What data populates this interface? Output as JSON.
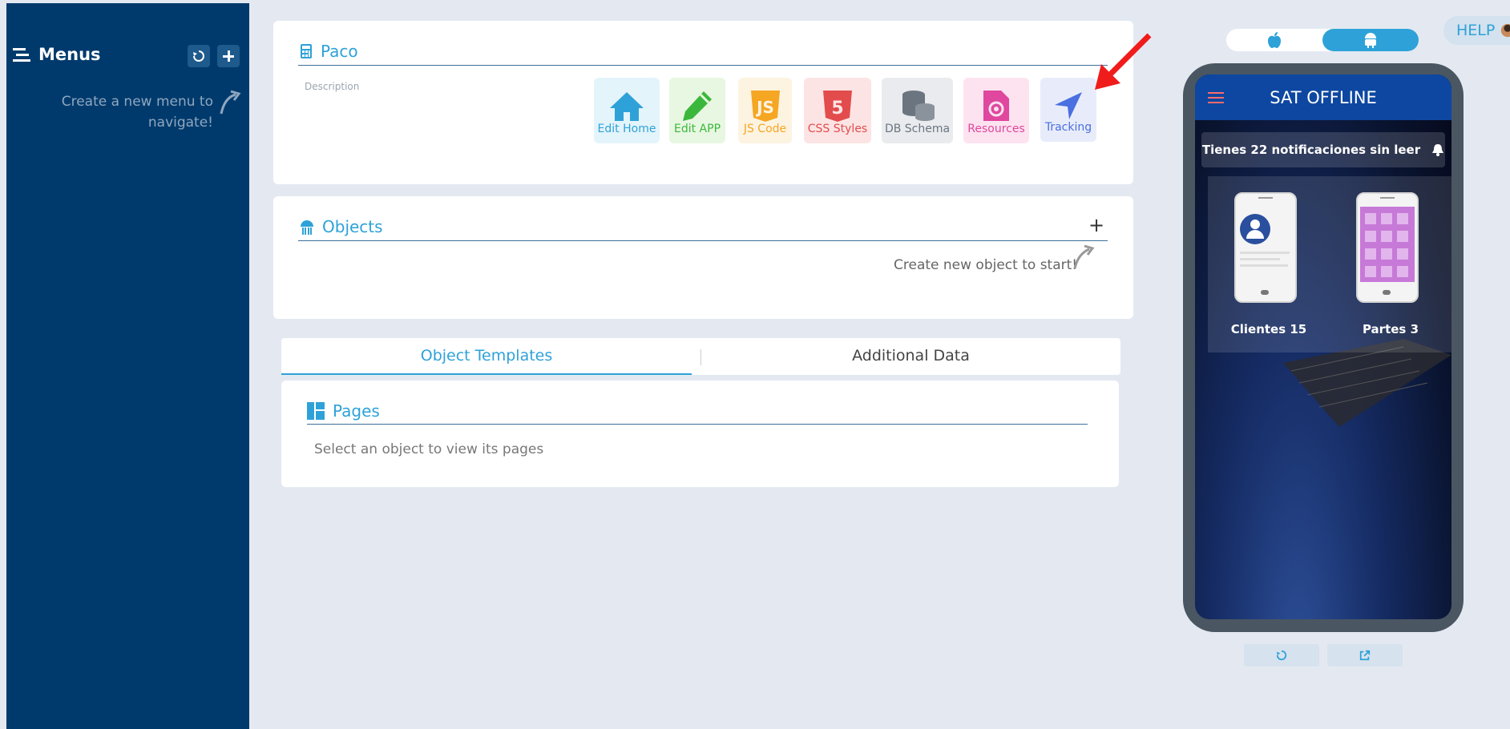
{
  "sidebar": {
    "title": "Menus",
    "refresh_icon": "refresh-icon",
    "add_icon": "plus-icon",
    "hint": "Create a new menu to navigate!"
  },
  "project": {
    "title": "Paco",
    "description_label": "Description",
    "tools": [
      {
        "label": "Edit Home",
        "icon": "home-icon",
        "color": "#2ea2d8"
      },
      {
        "label": "Edit APP",
        "icon": "pencil-icon",
        "color": "#3bb83b"
      },
      {
        "label": "JS Code",
        "icon": "js-icon",
        "color": "#f5a623"
      },
      {
        "label": "CSS Styles",
        "icon": "html5-icon",
        "color": "#e34c4c"
      },
      {
        "label": "DB Schema",
        "icon": "database-icon",
        "color": "#6b7580"
      },
      {
        "label": "Resources",
        "icon": "file-gear-icon",
        "color": "#e0479e"
      },
      {
        "label": "Tracking",
        "icon": "location-arrow-icon",
        "color": "#4a6fe0"
      }
    ]
  },
  "objects": {
    "title": "Objects",
    "add_label": "+",
    "hint": "Create new object to start!"
  },
  "tabs": {
    "items": [
      "Object Templates",
      "Additional Data"
    ],
    "active": 0
  },
  "pages": {
    "title": "Pages",
    "empty_text": "Select an object to view its pages"
  },
  "platform_toggle": {
    "options": [
      "apple-icon",
      "android-icon"
    ],
    "active": "android-icon"
  },
  "help": {
    "label": "HELP"
  },
  "phone": {
    "app_title": "SAT OFFLINE",
    "notification": "Tienes 22 notificaciones sin leer",
    "tiles": [
      {
        "label": "Clientes 15"
      },
      {
        "label": "Partes 3"
      }
    ],
    "buttons": [
      "refresh-icon",
      "external-link-icon"
    ]
  }
}
